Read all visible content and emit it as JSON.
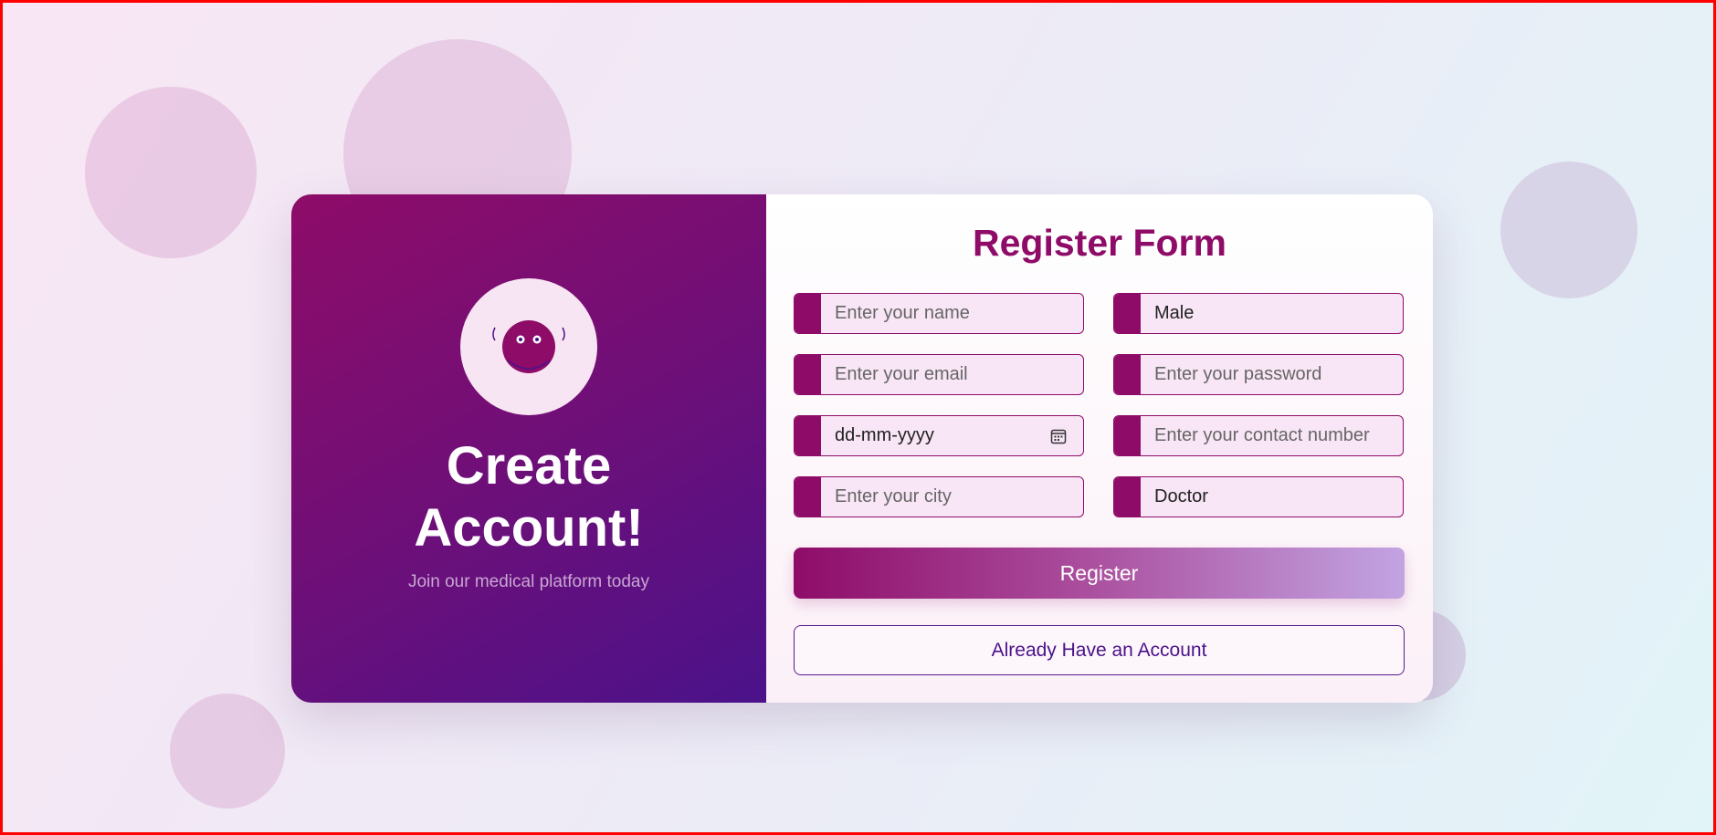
{
  "colors": {
    "primary": "#8e0c68",
    "secondary": "#4b128a",
    "field_bg": "#f8e5f5",
    "border_frame": "#ff0000"
  },
  "left_panel": {
    "avatar_icon": "cartoon-face-icon",
    "title": "Create Account!",
    "subtitle": "Join our medical platform today"
  },
  "form": {
    "title": "Register Form",
    "fields": {
      "name": {
        "placeholder": "Enter your name"
      },
      "gender": {
        "value": "Male",
        "icon": "dropdown"
      },
      "email": {
        "placeholder": "Enter your email"
      },
      "password": {
        "placeholder": "Enter your password"
      },
      "dob": {
        "placeholder": "dd-mm-yyyy",
        "icon": "calendar-icon"
      },
      "contact": {
        "placeholder": "Enter your contact number"
      },
      "city": {
        "placeholder": "Enter your city"
      },
      "role": {
        "value": "Doctor",
        "icon": "dropdown"
      }
    },
    "register_label": "Register",
    "login_label": "Already Have an Account"
  }
}
